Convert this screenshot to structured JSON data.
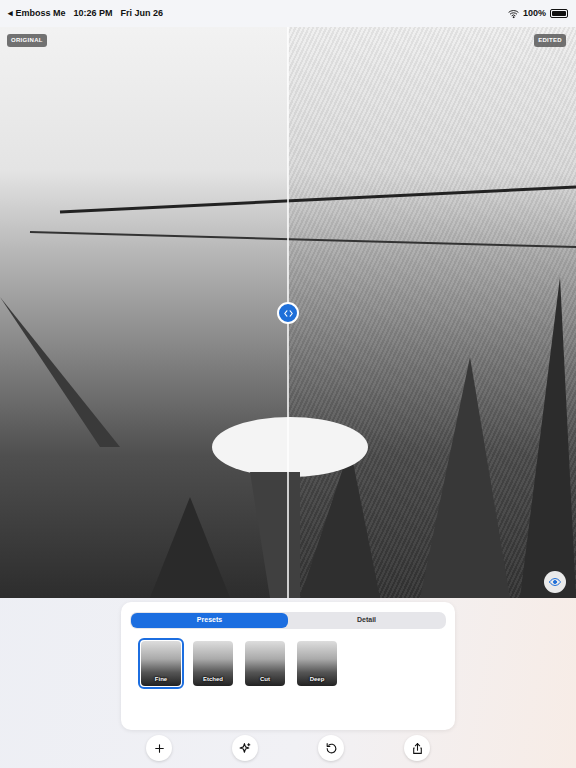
{
  "status_bar": {
    "back": "◂ Emboss Me",
    "time": "10:26 PM",
    "date": "Fri Jun 26",
    "battery": "100%",
    "battery_level": 1.0
  },
  "compare": {
    "left_label": "ORIGINAL",
    "right_label": "EDITED"
  },
  "segments": [
    {
      "label": "Presets",
      "selected": true
    },
    {
      "label": "Detail",
      "selected": false
    }
  ],
  "presets": [
    {
      "label": "Fine",
      "selected": true
    },
    {
      "label": "Etched",
      "selected": false
    },
    {
      "label": "Cut",
      "selected": false
    },
    {
      "label": "Deep",
      "selected": false
    }
  ]
}
